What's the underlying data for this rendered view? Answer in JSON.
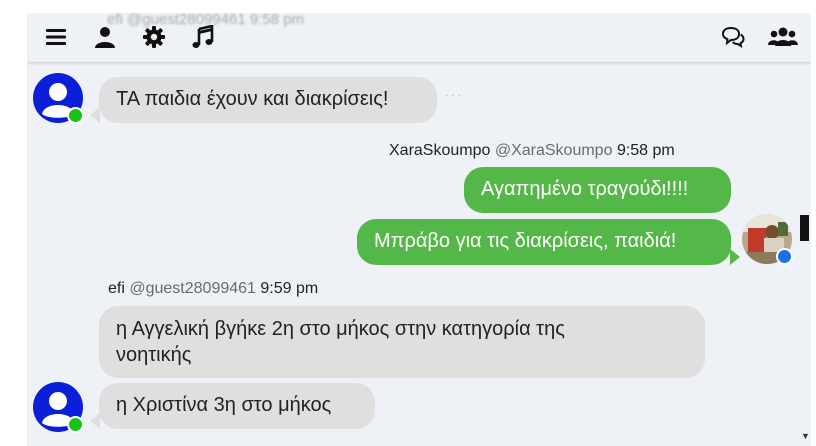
{
  "topbar": {
    "icons": [
      "menu-icon",
      "user-icon",
      "gear-icon",
      "music-icon",
      "chat-icon",
      "users-icon"
    ]
  },
  "ghost_header": {
    "text": "efi @guest28099461 9:58 pm"
  },
  "messages": [
    {
      "direction": "incoming",
      "text": "ΤΑ παιδια έχουν και διακρίσεις!",
      "status_color": "#19c219"
    },
    {
      "direction": "outgoing",
      "author": "XaraSkoumpo",
      "handle": "@XaraSkoumpo",
      "time": "9:58 pm",
      "texts": [
        "Αγαπημένο τραγούδι!!!!",
        "Μπράβο για τις διακρίσεις, παιδιά!"
      ],
      "status_color": "#1e6fe6"
    },
    {
      "direction": "incoming",
      "author": "efi",
      "handle": "@guest28099461",
      "time": "9:59 pm",
      "texts": [
        "η Αγγελική βγήκε 2η στο μήκος στην κατηγορία της νοητικής",
        "η Χριστίνα 3η στο μήκος"
      ],
      "status_color": "#19c219"
    }
  ],
  "colors": {
    "incoming_bubble": "#dfdfdf",
    "outgoing_bubble": "#54b848",
    "background": "#eef1f6",
    "default_avatar": "#0b1fd8"
  }
}
